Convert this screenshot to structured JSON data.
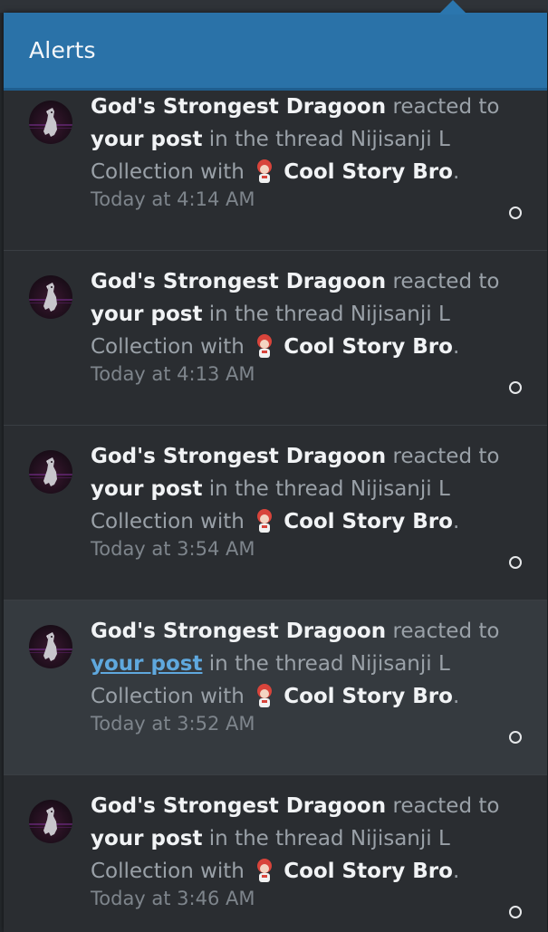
{
  "panel": {
    "title": "Alerts"
  },
  "alerts": [
    {
      "user": "God's Strongest Dragoon",
      "action": "reacted to",
      "target": "your post",
      "target_a": "your",
      "target_b": "post",
      "context": "in the thread Nijisanji L Collection",
      "with": "with",
      "reaction": "Cool Story Bro",
      "end": ".",
      "time": "Today at 4:14 AM",
      "highlighted": false
    },
    {
      "user": "God's Strongest Dragoon",
      "action": "reacted to",
      "target_a": "your",
      "target_b": "post",
      "context": "in the thread Nijisanji L Collection",
      "with": "with",
      "reaction": "Cool Story Bro",
      "end": ".",
      "time": "Today at 4:13 AM",
      "highlighted": false
    },
    {
      "user": "God's Strongest Dragoon",
      "action": "reacted to",
      "target_a": "your",
      "target_b": "post",
      "context": "in the thread Nijisanji L Collection",
      "with": "with",
      "reaction": "Cool Story Bro",
      "end": ".",
      "time": "Today at 3:54 AM",
      "highlighted": false
    },
    {
      "user": "God's Strongest Dragoon",
      "action": "reacted to",
      "target_a": "your",
      "target_b": "post",
      "context": "in the thread Nijisanji L Collection",
      "with": "with",
      "reaction": "Cool Story Bro",
      "end": ".",
      "time": "Today at 3:52 AM",
      "highlighted": true
    },
    {
      "user": "God's Strongest Dragoon",
      "action": "reacted to",
      "target_a": "your",
      "target_b": "post",
      "context": "in the thread Nijisanji L Collection",
      "with": "with",
      "reaction": "Cool Story Bro",
      "end": ".",
      "time": "Today at 3:46 AM",
      "highlighted": false
    }
  ],
  "colors": {
    "header_bg": "#2a72a8",
    "panel_bg": "#2a2d31",
    "highlight_bg": "#353a3f",
    "link": "#5fa8de"
  },
  "icons": {
    "avatar": "dragoon-avatar",
    "reaction": "cool-story-bro-reaction",
    "read_toggle": "mark-read-circle-icon"
  }
}
